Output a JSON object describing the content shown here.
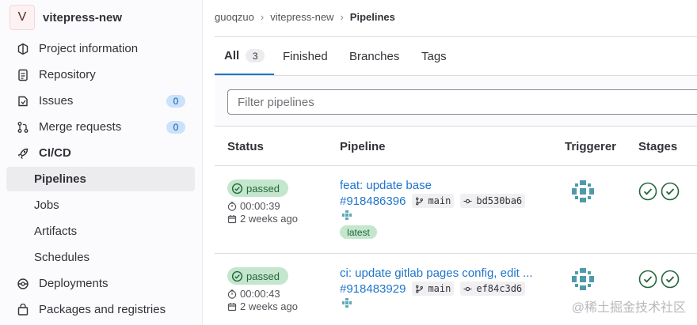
{
  "sidebar": {
    "project_initial": "V",
    "project_name": "vitepress-new",
    "items": [
      {
        "label": "Project information",
        "icon": "project-icon"
      },
      {
        "label": "Repository",
        "icon": "document-icon"
      },
      {
        "label": "Issues",
        "icon": "issues-icon",
        "badge": "0"
      },
      {
        "label": "Merge requests",
        "icon": "merge-request-icon",
        "badge": "0"
      },
      {
        "label": "CI/CD",
        "icon": "rocket-icon"
      },
      {
        "label": "Pipelines",
        "active": true
      },
      {
        "label": "Jobs"
      },
      {
        "label": "Artifacts"
      },
      {
        "label": "Schedules"
      },
      {
        "label": "Deployments",
        "icon": "deployments-icon"
      },
      {
        "label": "Packages and registries",
        "icon": "package-icon"
      }
    ]
  },
  "breadcrumb": [
    "guoqzuo",
    "vitepress-new",
    "Pipelines"
  ],
  "tabs": [
    {
      "label": "All",
      "count": "3",
      "active": true
    },
    {
      "label": "Finished"
    },
    {
      "label": "Branches"
    },
    {
      "label": "Tags"
    }
  ],
  "filter": {
    "placeholder": "Filter pipelines"
  },
  "table": {
    "headers": [
      "Status",
      "Pipeline",
      "Triggerer",
      "Stages"
    ],
    "rows": [
      {
        "status": "passed",
        "duration": "00:00:39",
        "finished": "2 weeks ago",
        "title": "feat: update base",
        "id": "#918486396",
        "branch": "main",
        "commit": "bd530ba6",
        "tag": "latest"
      },
      {
        "status": "passed",
        "duration": "00:00:43",
        "finished": "2 weeks ago",
        "title": "ci: update gitlab pages config, edit ...",
        "id": "#918483929",
        "branch": "main",
        "commit": "ef84c3d6"
      }
    ]
  },
  "watermark": "@稀土掘金技术社区",
  "colors": {
    "accent": "#1f75cb",
    "success_bg": "#c3e6cd",
    "success_fg": "#24663b"
  }
}
